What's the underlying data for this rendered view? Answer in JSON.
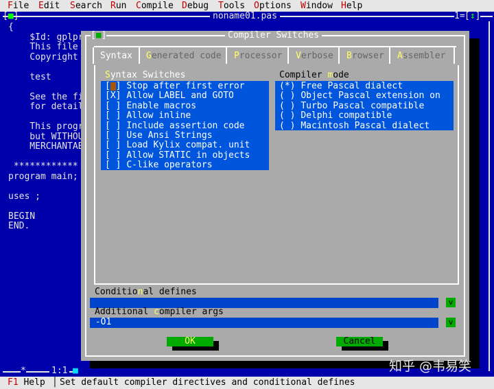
{
  "menu": [
    {
      "hotkey": "F",
      "rest": "ile"
    },
    {
      "hotkey": "E",
      "rest": "dit"
    },
    {
      "hotkey": "S",
      "rest": "earch"
    },
    {
      "hotkey": "R",
      "rest": "un"
    },
    {
      "hotkey": "C",
      "rest": "ompile"
    },
    {
      "hotkey": "D",
      "rest": "ebug"
    },
    {
      "hotkey": "T",
      "rest": "ools"
    },
    {
      "hotkey": "O",
      "rest": "ptions"
    },
    {
      "hotkey": "W",
      "rest": "indow"
    },
    {
      "hotkey": "H",
      "rest": "elp"
    }
  ],
  "editor": {
    "title": "noname01.pas",
    "window_number": "1",
    "close_glyph": "■",
    "zoom_glyph": "↕",
    "position": "1:1",
    "modified_marker": "*",
    "code_lines": [
      "{",
      "    $Id: gplpr",
      "    This file",
      "    Copyright",
      "",
      "    test",
      "",
      "    See the fi",
      "    for detail",
      "",
      "    This progr",
      "    but WITHOU",
      "    MERCHANTAB",
      "",
      " ************",
      "program main;",
      "",
      "uses ;",
      "",
      "BEGIN",
      "END."
    ]
  },
  "dialog": {
    "title": "Compiler Switches",
    "close_glyph": "■",
    "tabs": [
      {
        "hotkey": "",
        "rest": "Syntax",
        "active": true
      },
      {
        "hotkey": "G",
        "rest": "enerated code",
        "active": false
      },
      {
        "hotkey": "P",
        "rest": "rocessor",
        "active": false
      },
      {
        "hotkey": "V",
        "rest": "erbose",
        "active": false
      },
      {
        "hotkey": "B",
        "rest": "rowser",
        "active": false
      },
      {
        "hotkey": "A",
        "rest": "ssembler",
        "active": false
      }
    ],
    "syntax_switches": {
      "title_pre": "",
      "title_hk": "S",
      "title_post": "yntax Switches",
      "items": [
        {
          "mark": "[ ]",
          "label": "Stop after first error",
          "focused": true
        },
        {
          "mark": "[X]",
          "label": "Allow LABEL and GOTO"
        },
        {
          "mark": "[ ]",
          "label": "Enable macros"
        },
        {
          "mark": "[ ]",
          "label": "Allow inline"
        },
        {
          "mark": "[ ]",
          "label": "Include assertion code"
        },
        {
          "mark": "[ ]",
          "label": "Use Ansi Strings"
        },
        {
          "mark": "[ ]",
          "label": "Load Kylix compat. unit"
        },
        {
          "mark": "[ ]",
          "label": "Allow STATIC in objects"
        },
        {
          "mark": "[ ]",
          "label": "C-like operators"
        }
      ]
    },
    "compiler_mode": {
      "title_pre": "Compiler ",
      "title_hk": "m",
      "title_post": "ode",
      "items": [
        {
          "mark": "(*)",
          "label": "Free Pascal dialect"
        },
        {
          "mark": "( )",
          "label": "Object Pascal extension on"
        },
        {
          "mark": "( )",
          "label": "Turbo Pascal compatible"
        },
        {
          "mark": "( )",
          "label": "Delphi compatible"
        },
        {
          "mark": "( )",
          "label": "Macintosh Pascal dialect"
        }
      ]
    },
    "conditional_defines": {
      "label_pre": "Conditio",
      "label_hk": "n",
      "label_post": "al defines",
      "value": ""
    },
    "additional_args": {
      "label_pre": "Additional ",
      "label_hk": "c",
      "label_post": "ompiler args",
      "value": " -O1"
    },
    "dropdown_glyph": "v",
    "ok_label": "OK",
    "cancel_label": "Cancel"
  },
  "status": {
    "key": "F1",
    "key_label": "Help",
    "separator": "│",
    "message": "Set default compiler directives and conditional defines"
  },
  "watermark": "知乎 @韦易笑",
  "colors": {
    "desktop_blue": "#0000aa",
    "dialog_gray": "#aaaaaa",
    "list_blue": "#0055dd",
    "button_green": "#00aa00",
    "hotkey_red": "#c00000",
    "hotkey_yellow": "#ffff66"
  }
}
